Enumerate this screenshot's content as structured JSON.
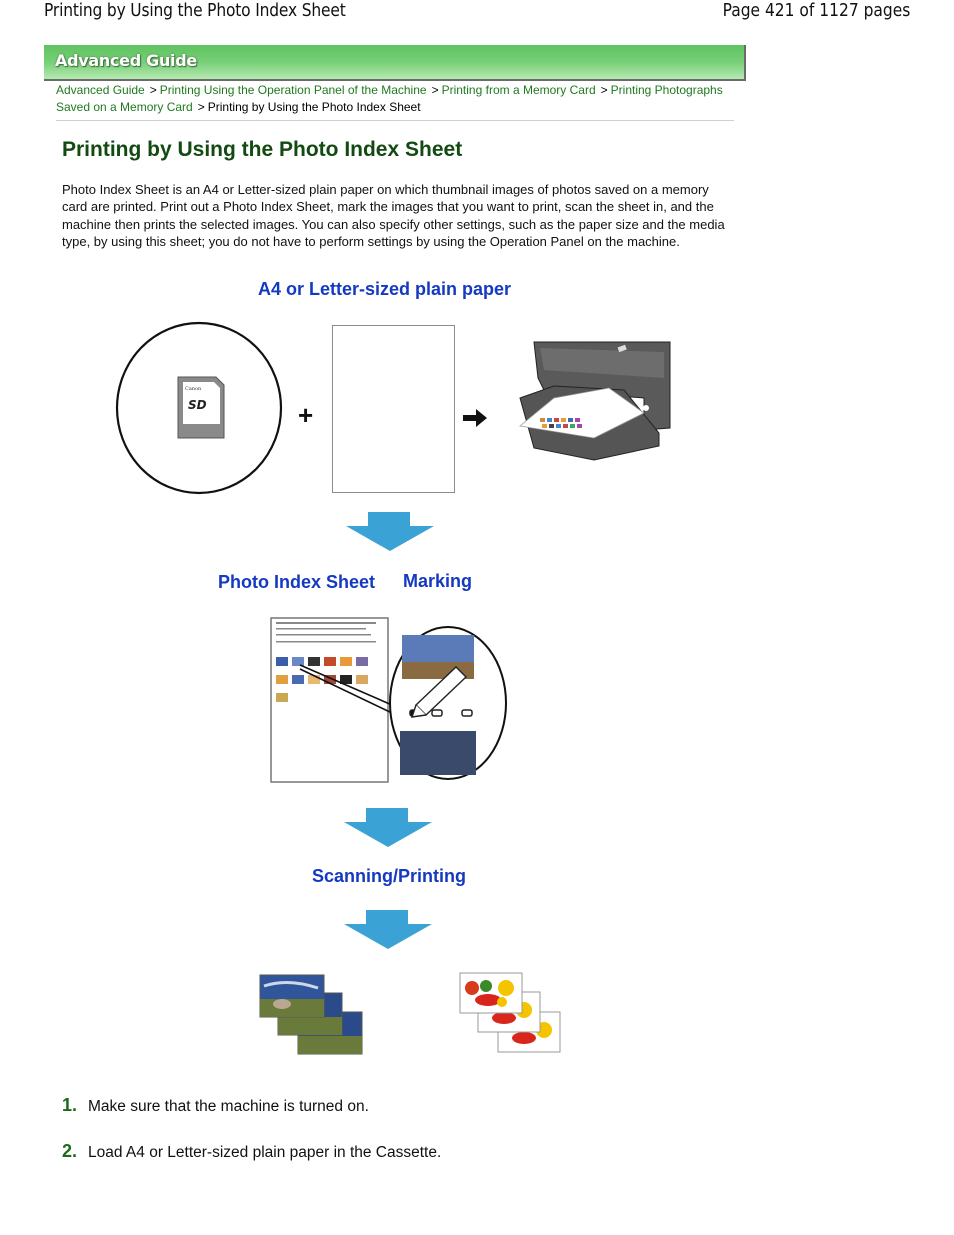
{
  "header": {
    "doc_title": "Printing by Using the Photo Index Sheet",
    "page_count": "Page 421 of 1127 pages"
  },
  "banner": {
    "label": "Advanced Guide"
  },
  "breadcrumb": {
    "links": [
      "Advanced Guide",
      "Printing Using the Operation Panel of the Machine",
      "Printing from a Memory Card",
      "Printing Photographs Saved on a Memory Card"
    ],
    "separator": ">",
    "current": "Printing by Using the Photo Index Sheet"
  },
  "main": {
    "title": "Printing by Using the Photo Index Sheet",
    "intro": "Photo Index Sheet is an A4 or Letter-sized plain paper on which thumbnail images of photos saved on a memory card are printed. Print out a Photo Index Sheet, mark the images that you want to print, scan the sheet in, and the machine then prints the selected images. You can also specify other settings, such as the paper size and the media type, by using this sheet; you do not have to perform settings by using the Operation Panel on the machine."
  },
  "diagram": {
    "caption_paper": "A4 or Letter-sized plain paper",
    "sd_card_brand": "Canon",
    "sd_card_logo": "SD",
    "plus_symbol": "+",
    "arrow_symbol": "➡",
    "caption_index_sheet": "Photo Index Sheet",
    "caption_marking": "Marking",
    "caption_scanning": "Scanning/Printing",
    "arrow_color": "#3aa2d4"
  },
  "steps": [
    {
      "num": "1.",
      "text": "Make sure that the machine is turned on."
    },
    {
      "num": "2.",
      "text": "Load A4 or Letter-sized plain paper in the Cassette."
    }
  ]
}
